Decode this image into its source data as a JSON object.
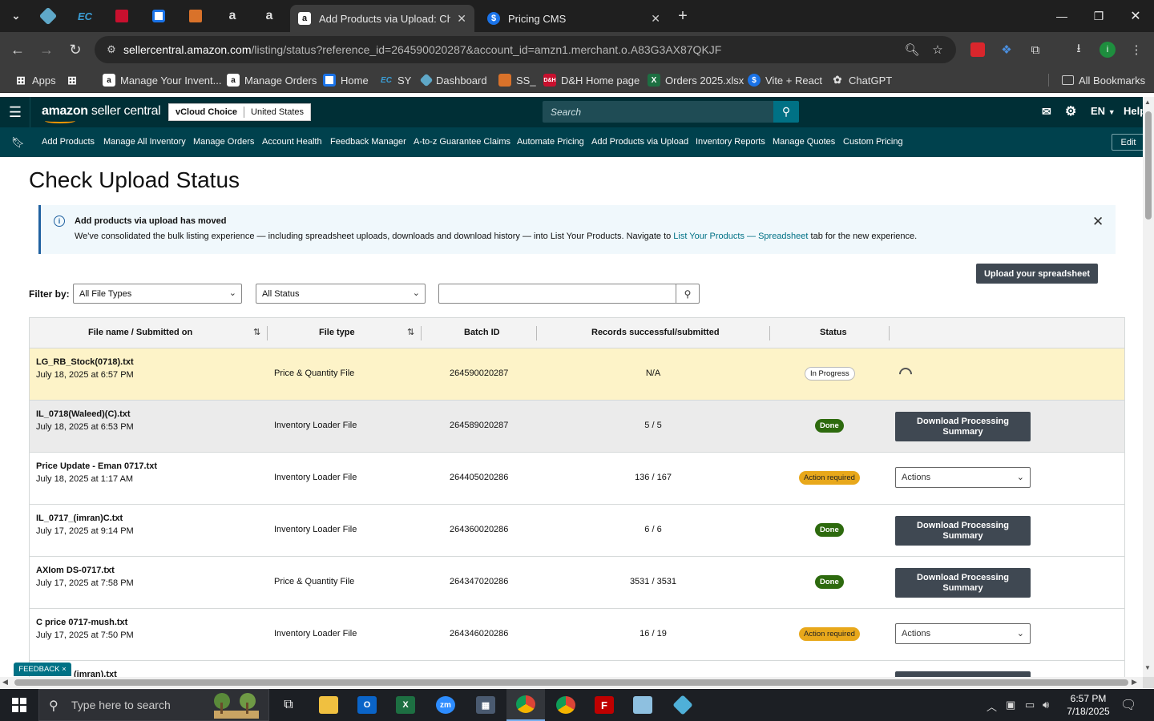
{
  "browser": {
    "active_tab_title": "Add Products via Upload: Check",
    "tab2_title": "Pricing CMS",
    "url_domain": "sellercentral.amazon.com",
    "url_path": "/listing/status?reference_id=264590020287&account_id=amzn1.merchant.o.A83G3AX87QKJF",
    "bookmarks": [
      {
        "label": "Apps"
      },
      {
        "label": "Manage Your Invent..."
      },
      {
        "label": "Manage Orders"
      },
      {
        "label": "Home"
      },
      {
        "label": "SY"
      },
      {
        "label": "Dashboard"
      },
      {
        "label": "SS_"
      },
      {
        "label": "D&H Home page"
      },
      {
        "label": "Orders 2025.xlsx"
      },
      {
        "label": "Vite + React"
      },
      {
        "label": "ChatGPT"
      }
    ],
    "all_bookmarks": "All Bookmarks"
  },
  "header": {
    "logo_bold": "amazon",
    "logo_light": " seller central",
    "account": "vCloud Choice",
    "marketplace": "United States",
    "search_placeholder": "Search",
    "language": "EN",
    "help": "Help"
  },
  "nav": {
    "links": [
      "Add Products",
      "Manage All Inventory",
      "Manage Orders",
      "Account Health",
      "Feedback Manager",
      "A-to-z Guarantee Claims",
      "Automate Pricing",
      "Add Products via Upload",
      "Inventory Reports",
      "Manage Quotes",
      "Custom Pricing"
    ],
    "edit": "Edit"
  },
  "page": {
    "title": "Check Upload Status",
    "banner_title": "Add products via upload has moved",
    "banner_body_pre": "We've consolidated the bulk listing experience — including spreadsheet uploads, downloads and download history — into List Your Products. Navigate to ",
    "banner_link": "List Your Products — Spreadsheet",
    "banner_body_post": " tab for the new experience.",
    "upload_button": "Upload your spreadsheet",
    "filter_label": "Filter by:",
    "filter_type": "All File Types",
    "filter_status": "All Status",
    "feedback": "FEEDBACK ×"
  },
  "table": {
    "headers": {
      "file": "File name / Submitted on",
      "type": "File type",
      "batch": "Batch ID",
      "records": "Records successful/submitted",
      "status": "Status"
    },
    "rows": [
      {
        "name": "LG_RB_Stock(0718).txt",
        "date": "July 18, 2025 at 6:57 PM",
        "type": "Price & Quantity File",
        "batch": "264590020287",
        "records": "N/A",
        "status": "In Progress"
      },
      {
        "name": "IL_0718(Waleed)(C).txt",
        "date": "July 18, 2025 at 6:53 PM",
        "type": "Inventory Loader File",
        "batch": "264589020287",
        "records": "5 / 5",
        "status": "Done",
        "action": "Download Processing Summary"
      },
      {
        "name": "Price Update - Eman 0717.txt",
        "date": "July 18, 2025 at 1:17 AM",
        "type": "Inventory Loader File",
        "batch": "264405020286",
        "records": "136 / 167",
        "status": "Action required",
        "action": "Actions"
      },
      {
        "name": "IL_0717_(imran)C.txt",
        "date": "July 17, 2025 at 9:14 PM",
        "type": "Inventory Loader File",
        "batch": "264360020286",
        "records": "6 / 6",
        "status": "Done",
        "action": "Download Processing Summary"
      },
      {
        "name": "AXIom DS-0717.txt",
        "date": "July 17, 2025 at 7:58 PM",
        "type": "Price & Quantity File",
        "batch": "264347020286",
        "records": "3531 / 3531",
        "status": "Done",
        "action": "Download Processing Summary"
      },
      {
        "name": "C price 0717-mush.txt",
        "date": "July 17, 2025 at 7:50 PM",
        "type": "Inventory Loader File",
        "batch": "264346020286",
        "records": "16 / 19",
        "status": "Action required",
        "action": "Actions"
      },
      {
        "name": "(imran).txt"
      }
    ]
  },
  "taskbar": {
    "search_placeholder": "Type here to search",
    "time": "6:57 PM",
    "date": "7/18/2025"
  }
}
